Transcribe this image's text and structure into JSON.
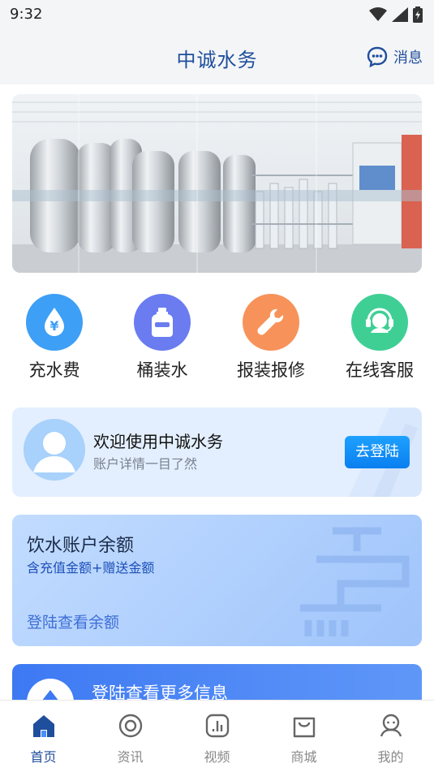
{
  "status_bar": {
    "time": "9:32"
  },
  "header": {
    "title": "中诚水务",
    "message_label": "消息"
  },
  "quick_actions": [
    {
      "label": "充水费",
      "icon": "water-drop-yuan-icon",
      "color": "#3d9ff5"
    },
    {
      "label": "桶装水",
      "icon": "water-bucket-icon",
      "color": "#6b7cf0"
    },
    {
      "label": "报装报修",
      "icon": "wrench-icon",
      "color": "#f7935a"
    },
    {
      "label": "在线客服",
      "icon": "headset-icon",
      "color": "#3fcf95"
    }
  ],
  "login_card": {
    "title": "欢迎使用中诚水务",
    "subtitle": "账户详情一目了然",
    "button": "去登陆"
  },
  "balance_card": {
    "title": "饮水账户余额",
    "subtitle": "含充值金额+赠送金额",
    "link": "登陆查看余额"
  },
  "more_card": {
    "title": "登陆查看更多信息"
  },
  "tabbar": {
    "items": [
      {
        "label": "首页",
        "icon": "home-icon",
        "active": true
      },
      {
        "label": "资讯",
        "icon": "news-icon",
        "active": false
      },
      {
        "label": "视频",
        "icon": "video-icon",
        "active": false
      },
      {
        "label": "商城",
        "icon": "shop-bag-icon",
        "active": false
      },
      {
        "label": "我的",
        "icon": "profile-icon",
        "active": false
      }
    ]
  },
  "colors": {
    "primary": "#1f4e9c",
    "accent": "#0a7ff0"
  }
}
